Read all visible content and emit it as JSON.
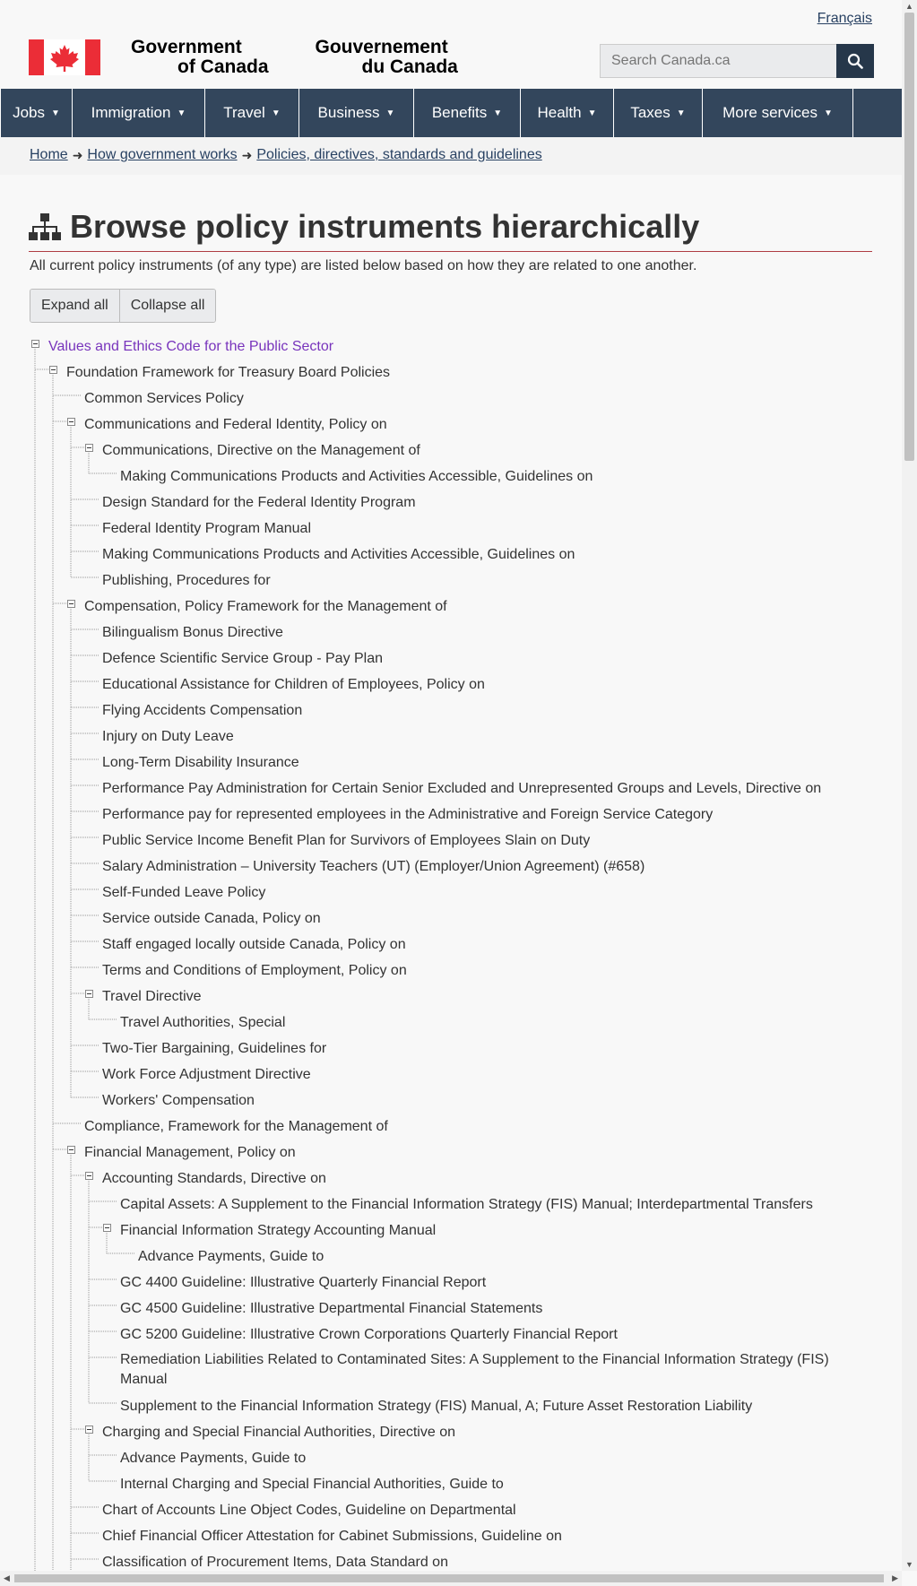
{
  "header": {
    "language_link": "Français",
    "wordmark_en": [
      "Government",
      "of Canada"
    ],
    "wordmark_fr": [
      "Gouvernement",
      "du Canada"
    ],
    "search_placeholder": "Search Canada.ca"
  },
  "menu": [
    "Jobs",
    "Immigration",
    "Travel",
    "Business",
    "Benefits",
    "Health",
    "Taxes",
    "More services"
  ],
  "breadcrumb": [
    "Home",
    "How government works",
    "Policies, directives, standards and guidelines"
  ],
  "page": {
    "title": "Browse policy instruments hierarchically",
    "intro": "All current policy instruments (of any type) are listed below based on how they are related to one another.",
    "expand_all": "Expand all",
    "collapse_all": "Collapse all"
  },
  "tree": [
    {
      "label": "Values and Ethics Code for the Public Sector",
      "level": 0,
      "toggle": true,
      "visited": true
    },
    {
      "label": "Foundation Framework for Treasury Board Policies",
      "level": 1,
      "toggle": true
    },
    {
      "label": "Common Services Policy",
      "level": 2
    },
    {
      "label": "Communications and Federal Identity, Policy on",
      "level": 2,
      "toggle": true
    },
    {
      "label": "Communications, Directive on the Management of",
      "level": 3,
      "toggle": true
    },
    {
      "label": "Making Communications Products and Activities Accessible, Guidelines on",
      "level": 4
    },
    {
      "label": "Design Standard for the Federal Identity Program",
      "level": 3
    },
    {
      "label": "Federal Identity Program Manual",
      "level": 3
    },
    {
      "label": "Making Communications Products and Activities Accessible, Guidelines on",
      "level": 3
    },
    {
      "label": "Publishing, Procedures for",
      "level": 3
    },
    {
      "label": "Compensation, Policy Framework for the Management of",
      "level": 2,
      "toggle": true
    },
    {
      "label": "Bilingualism Bonus Directive",
      "level": 3
    },
    {
      "label": "Defence Scientific Service Group - Pay Plan",
      "level": 3
    },
    {
      "label": "Educational Assistance for Children of Employees, Policy on",
      "level": 3
    },
    {
      "label": "Flying Accidents Compensation",
      "level": 3
    },
    {
      "label": "Injury on Duty Leave",
      "level": 3
    },
    {
      "label": "Long-Term Disability Insurance",
      "level": 3
    },
    {
      "label": "Performance Pay Administration for Certain Senior Excluded and Unrepresented Groups and Levels, Directive on",
      "level": 3
    },
    {
      "label": "Performance pay for represented employees in the Administrative and Foreign Service Category",
      "level": 3
    },
    {
      "label": "Public Service Income Benefit Plan for Survivors of Employees Slain on Duty",
      "level": 3
    },
    {
      "label": "Salary Administration – University Teachers (UT) (Employer/Union Agreement) (#658)",
      "level": 3
    },
    {
      "label": "Self-Funded Leave Policy",
      "level": 3
    },
    {
      "label": "Service outside Canada, Policy on",
      "level": 3
    },
    {
      "label": "Staff engaged locally outside Canada, Policy on",
      "level": 3
    },
    {
      "label": "Terms and Conditions of Employment, Policy on",
      "level": 3
    },
    {
      "label": "Travel Directive",
      "level": 3,
      "toggle": true
    },
    {
      "label": "Travel Authorities, Special",
      "level": 4
    },
    {
      "label": "Two-Tier Bargaining, Guidelines for",
      "level": 3
    },
    {
      "label": "Work Force Adjustment Directive",
      "level": 3
    },
    {
      "label": "Workers' Compensation",
      "level": 3
    },
    {
      "label": "Compliance, Framework for the Management of",
      "level": 2
    },
    {
      "label": "Financial Management, Policy on",
      "level": 2,
      "toggle": true
    },
    {
      "label": "Accounting Standards, Directive on",
      "level": 3,
      "toggle": true
    },
    {
      "label": "Capital Assets: A Supplement to the Financial Information Strategy (FIS) Manual; Interdepartmental Transfers",
      "level": 4
    },
    {
      "label": "Financial Information Strategy Accounting Manual",
      "level": 4,
      "toggle": true
    },
    {
      "label": "Advance Payments, Guide to",
      "level": 5
    },
    {
      "label": "GC 4400 Guideline: Illustrative Quarterly Financial Report",
      "level": 4
    },
    {
      "label": "GC 4500 Guideline: Illustrative Departmental Financial Statements",
      "level": 4
    },
    {
      "label": "GC 5200 Guideline: Illustrative Crown Corporations Quarterly Financial Report",
      "level": 4
    },
    {
      "label": "Remediation Liabilities Related to Contaminated Sites: A Supplement to the Financial Information Strategy (FIS) Manual",
      "level": 4,
      "wrap": true
    },
    {
      "label": "Supplement to the Financial Information Strategy (FIS) Manual, A; Future Asset Restoration Liability",
      "level": 4
    },
    {
      "label": "Charging and Special Financial Authorities, Directive on",
      "level": 3,
      "toggle": true
    },
    {
      "label": "Advance Payments, Guide to",
      "level": 4
    },
    {
      "label": "Internal Charging and Special Financial Authorities, Guide to",
      "level": 4
    },
    {
      "label": "Chart of Accounts Line Object Codes, Guideline on Departmental",
      "level": 3
    },
    {
      "label": "Chief Financial Officer Attestation for Cabinet Submissions, Guideline on",
      "level": 3
    },
    {
      "label": "Classification of Procurement Items, Data Standard on",
      "level": 3
    }
  ]
}
